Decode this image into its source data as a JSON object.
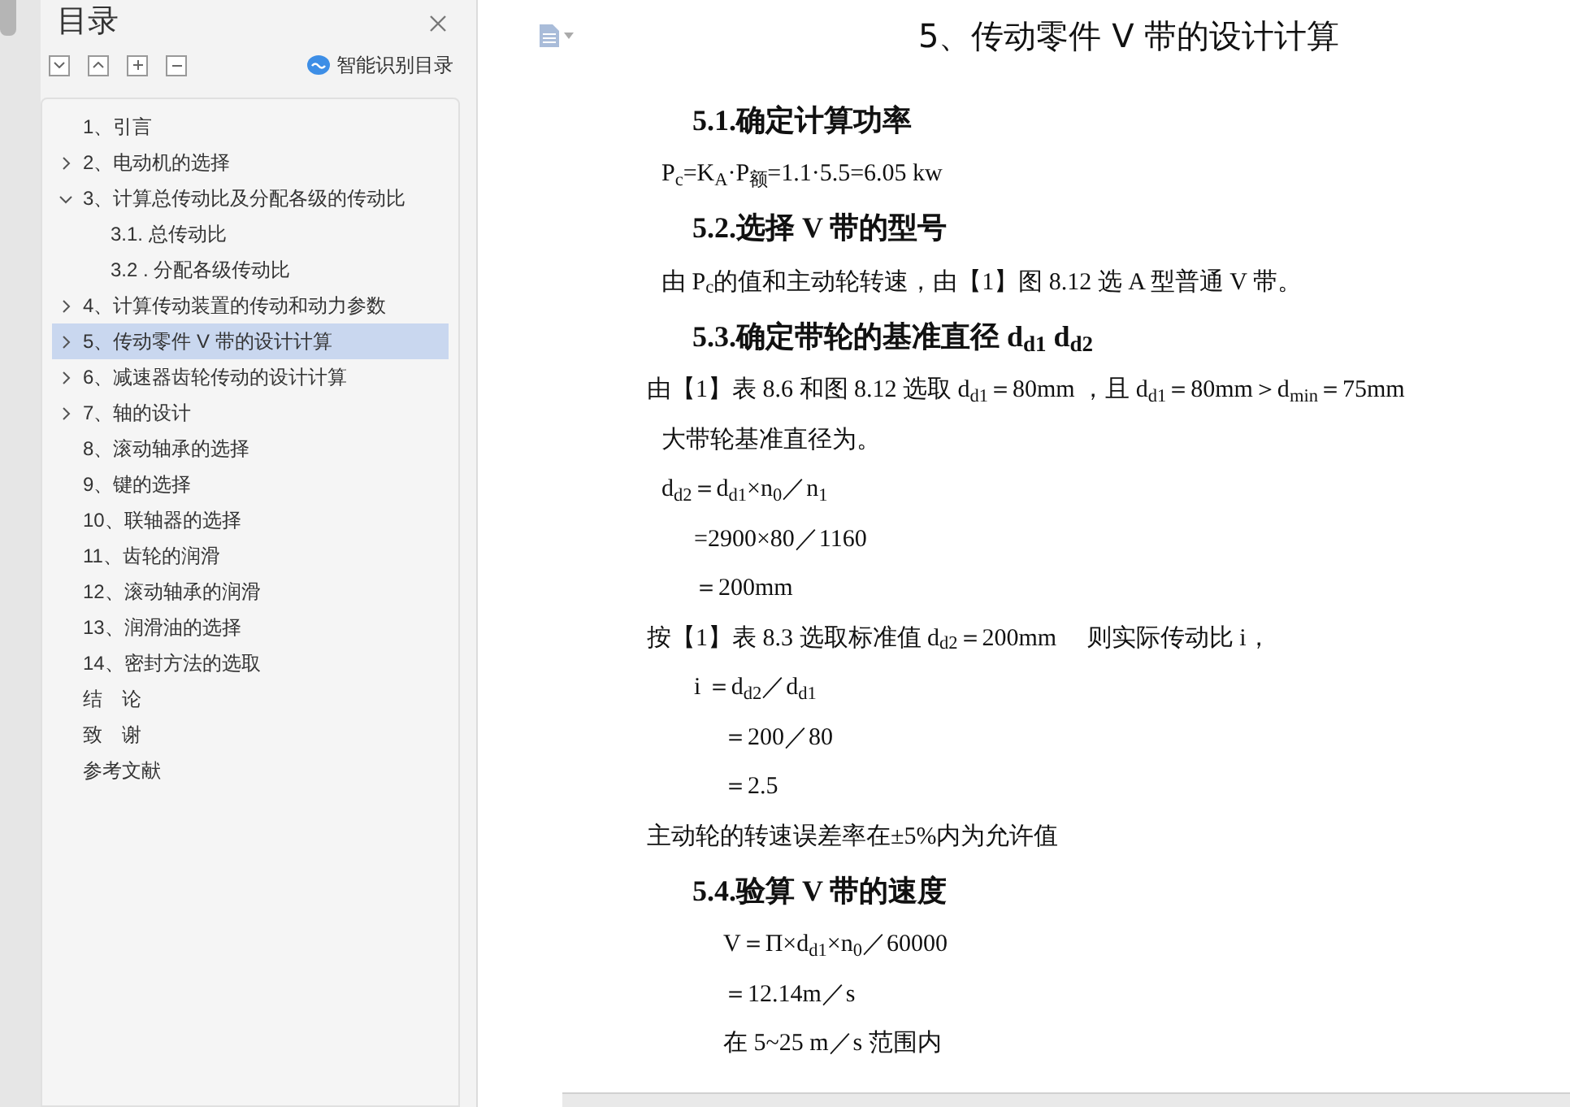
{
  "sidebar": {
    "title": "目录",
    "smart_button": "智能识别目录",
    "toolbar": [
      {
        "kind": "down"
      },
      {
        "kind": "up"
      },
      {
        "kind": "plus"
      },
      {
        "kind": "minus"
      }
    ],
    "items": [
      {
        "label": "1、引言",
        "selected": false
      },
      {
        "label": "2、电动机的选择",
        "expanded": false,
        "selected": false
      },
      {
        "label": "3、计算总传动比及分配各级的传动比",
        "expanded": true,
        "selected": false,
        "children": [
          {
            "label": "3.1. 总传动比",
            "selected": false
          },
          {
            "label": "3.2 . 分配各级传动比",
            "selected": false
          }
        ]
      },
      {
        "label": "4、计算传动装置的传动和动力参数",
        "expanded": false,
        "selected": false
      },
      {
        "label": "5、传动零件 V 带的设计计算",
        "expanded": false,
        "selected": true
      },
      {
        "label": "6、减速器齿轮传动的设计计算",
        "expanded": false,
        "selected": false
      },
      {
        "label": "7、轴的设计",
        "expanded": false,
        "selected": false
      },
      {
        "label": "8、滚动轴承的选择",
        "selected": false
      },
      {
        "label": "9、键的选择",
        "selected": false
      },
      {
        "label": "10、联轴器的选择",
        "selected": false
      },
      {
        "label": "11、齿轮的润滑",
        "selected": false
      },
      {
        "label": "12、滚动轴承的润滑",
        "selected": false
      },
      {
        "label": "13、润滑油的选择",
        "selected": false
      },
      {
        "label": "14、密封方法的选取",
        "selected": false
      },
      {
        "label": "结　论",
        "selected": false
      },
      {
        "label": "致　谢",
        "selected": false
      },
      {
        "label": "参考文献",
        "selected": false
      }
    ]
  },
  "document": {
    "title": "5、传动零件 V 带的设计计算",
    "blocks": [
      {
        "kind": "heading",
        "text": "5.1.确定计算功率"
      },
      {
        "kind": "formula",
        "text": "P$_{c}$=K$_{A}$·P$_{额}$=1.1·5.5=6.05 kw"
      },
      {
        "kind": "heading",
        "text": "5.2.选择 V 带的型号"
      },
      {
        "kind": "formula",
        "text": "由 P$_{c}$的值和主动轮转速，由【1】图 8.12 选 A 型普通 V 带。"
      },
      {
        "kind": "heading",
        "text": "5.3.确定带轮的基准直径 d$_{d1}$ d$_{d2}$"
      },
      {
        "kind": "text",
        "text": "由【1】表 8.6 和图 8.12 选取 d$_{d1}$＝80mm ，且 d$_{d1}$＝80mm＞d$_{min}$＝75mm"
      },
      {
        "kind": "formula",
        "text": "大带轮基准直径为。"
      },
      {
        "kind": "formula",
        "text": "d$_{d2}$＝d$_{d1}$×n$_{0}$／n$_{1}$"
      },
      {
        "kind": "step",
        "text": "=2900×80／1160"
      },
      {
        "kind": "step",
        "text": "＝200mm"
      },
      {
        "kind": "text",
        "text": "按【1】表 8.3 选取标准值 d$_{d2}$＝200mm　 则实际传动比 i，"
      },
      {
        "kind": "step",
        "text": "i ＝d$_{d2}$／d$_{d1}$"
      },
      {
        "kind": "result",
        "text": "＝200／80"
      },
      {
        "kind": "result",
        "text": "＝2.5"
      },
      {
        "kind": "text",
        "text": "主动轮的转速误差率在±5%内为允许值"
      },
      {
        "kind": "heading",
        "text": "5.4.验算 V 带的速度"
      },
      {
        "kind": "result",
        "text": "V＝Π×d$_{d1}$×n$_{0}$／60000"
      },
      {
        "kind": "result",
        "text": "＝12.14m／s"
      },
      {
        "kind": "result",
        "text": "在 5~25 m／s 范围内"
      }
    ]
  }
}
